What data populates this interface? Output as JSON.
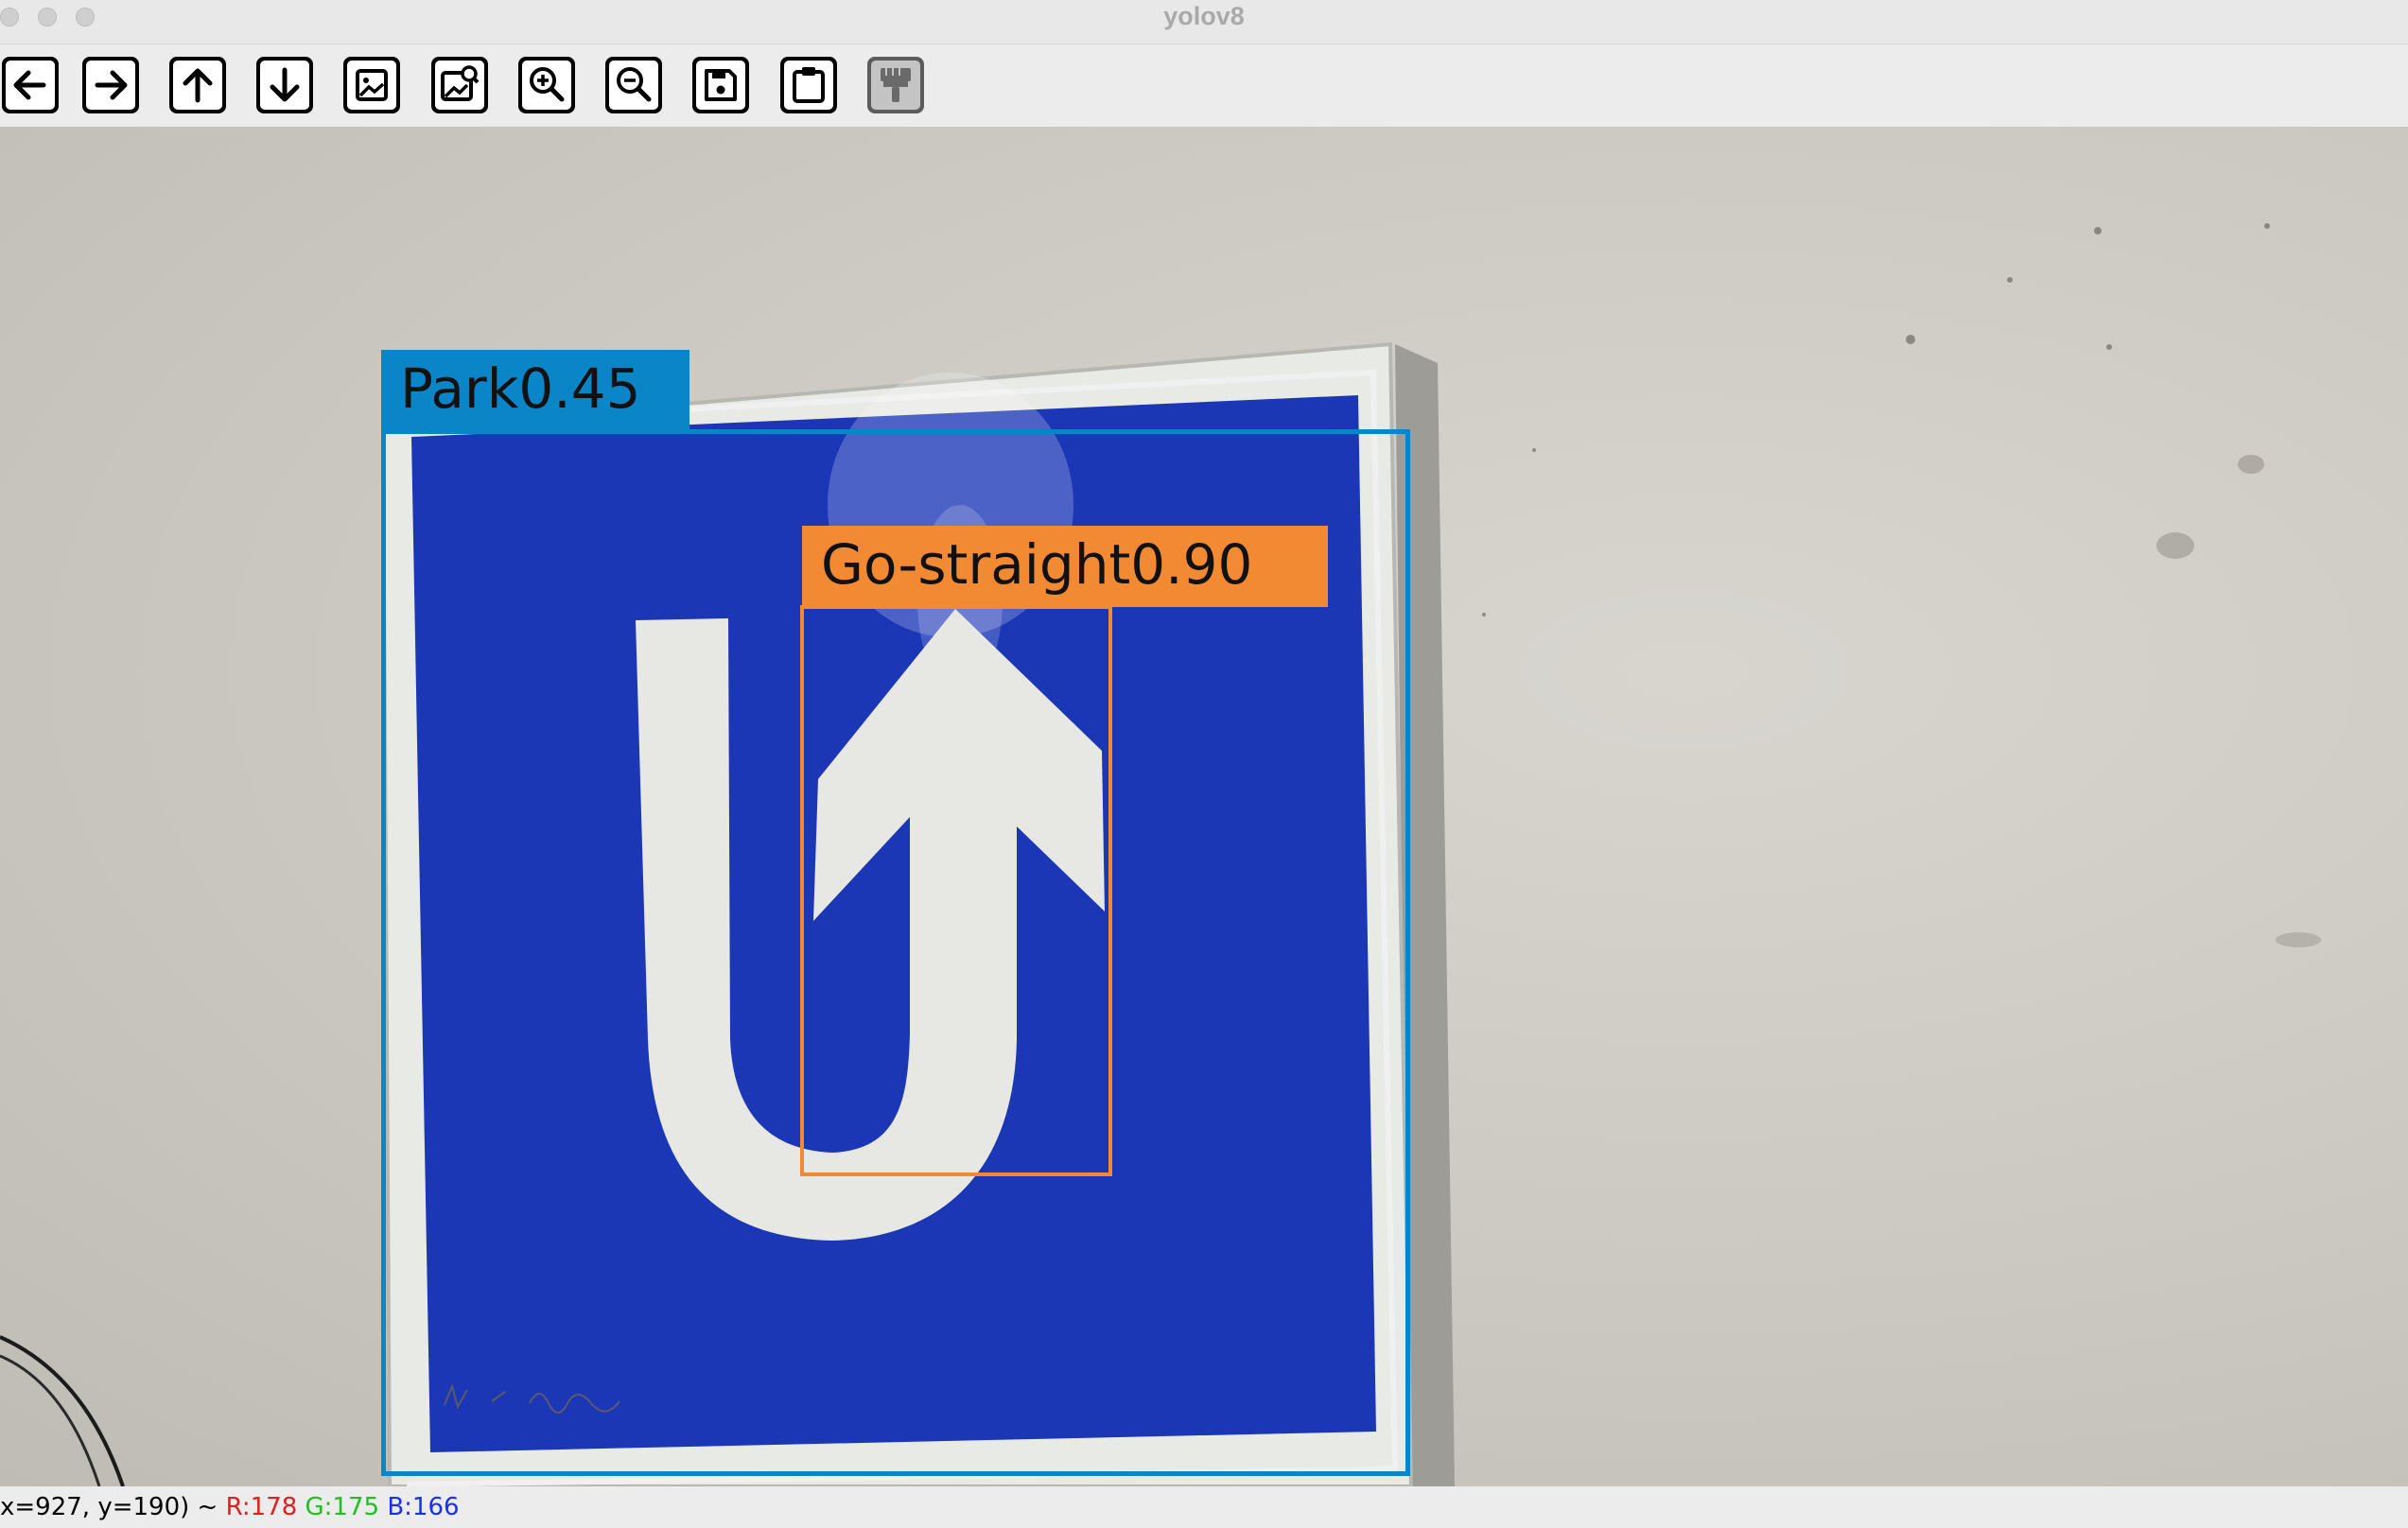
{
  "window": {
    "title": "yolov8"
  },
  "toolbar": {
    "buttons": [
      {
        "name": "back-button",
        "icon": "arrow-left-icon"
      },
      {
        "name": "forward-button",
        "icon": "arrow-right-icon"
      },
      {
        "name": "up-button",
        "icon": "arrow-up-icon"
      },
      {
        "name": "down-button",
        "icon": "arrow-down-icon"
      },
      {
        "name": "image-button",
        "icon": "image-icon"
      },
      {
        "name": "image-properties-button",
        "icon": "image-properties-icon"
      },
      {
        "name": "zoom-in-button",
        "icon": "zoom-in-icon"
      },
      {
        "name": "zoom-out-button",
        "icon": "zoom-out-icon"
      },
      {
        "name": "save-button",
        "icon": "save-icon"
      },
      {
        "name": "copy-clipboard-button",
        "icon": "clipboard-icon"
      },
      {
        "name": "properties-button",
        "icon": "paint-brush-icon"
      }
    ]
  },
  "detections": [
    {
      "label": "Park0.45",
      "color": "#0a85c8"
    },
    {
      "label": "Go-straight0.90",
      "color": "#f28a34"
    }
  ],
  "status": {
    "coords": "x=927, y=190) ~ ",
    "r": "R:178",
    "g": "G:175",
    "b": "B:166"
  },
  "colors": {
    "sign_blue": "#1b37b6",
    "sign_white": "#e8eae6",
    "wall": "#cbc8c1"
  }
}
